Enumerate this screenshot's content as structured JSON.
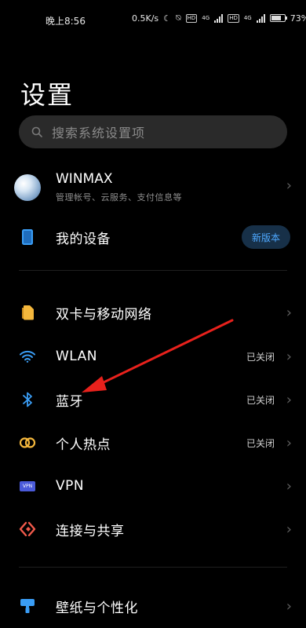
{
  "status_bar": {
    "time": "晚上8:56",
    "speed": "0.5K/s",
    "hd1": "HD",
    "net1": "4G",
    "hd2": "HD",
    "net2": "4G",
    "battery": "73%",
    "battery_level": 0.73
  },
  "page": {
    "title": "设置"
  },
  "search": {
    "placeholder": "搜索系统设置项"
  },
  "account": {
    "name": "WINMAX",
    "subtitle": "管理帐号、云服务、支付信息等"
  },
  "my_device": {
    "label": "我的设备",
    "badge": "新版本"
  },
  "items": [
    {
      "label": "双卡与移动网络",
      "status": "",
      "icon": "sim-card-icon",
      "color": "#f4b73c"
    },
    {
      "label": "WLAN",
      "status": "已关闭",
      "icon": "wifi-icon",
      "color": "#3a9df5"
    },
    {
      "label": "蓝牙",
      "status": "已关闭",
      "icon": "bluetooth-icon",
      "color": "#3a9df5"
    },
    {
      "label": "个人热点",
      "status": "已关闭",
      "icon": "hotspot-icon",
      "color": "#f4b73c"
    },
    {
      "label": "VPN",
      "status": "",
      "icon": "vpn-icon",
      "color": "#4a5ad9",
      "icon_text": "VPN"
    },
    {
      "label": "连接与共享",
      "status": "",
      "icon": "connection-share-icon",
      "color": "#f25a4b"
    },
    {
      "label": "壁纸与个性化",
      "status": "",
      "icon": "wallpaper-icon",
      "color": "#3a9df5"
    }
  ],
  "annotation": {
    "arrow_color": "#e8211c"
  }
}
